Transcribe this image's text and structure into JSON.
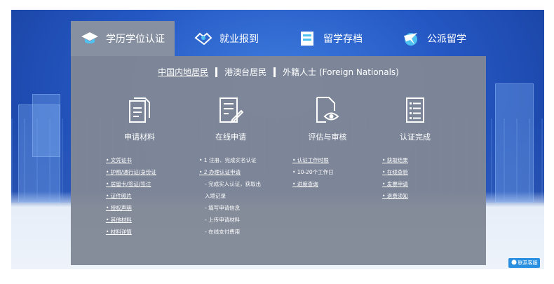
{
  "tabs": [
    {
      "label": "学历学位认证",
      "icon": "graduation-cap-icon",
      "active": true
    },
    {
      "label": "就业报到",
      "icon": "handshake-icon",
      "active": false
    },
    {
      "label": "留学存档",
      "icon": "file-cabinet-icon",
      "active": false
    },
    {
      "label": "公派留学",
      "icon": "airplane-globe-icon",
      "active": false
    }
  ],
  "subnav": {
    "mainland": "中国内地居民",
    "hkmt": "港澳台居民",
    "foreign": "外籍人士 (Foreign Nationals)"
  },
  "steps": [
    {
      "label": "申请材料",
      "icon": "documents-icon"
    },
    {
      "label": "在线申请",
      "icon": "form-edit-icon"
    },
    {
      "label": "评估与审核",
      "icon": "document-eye-icon"
    },
    {
      "label": "认证完成",
      "icon": "checklist-icon"
    }
  ],
  "materials": [
    "• 文凭证书",
    "• 护照/通行证/身份证",
    "• 居留卡/签证/签注",
    "• 证件照片",
    "• 授权声明",
    "• 其他材料",
    "• 材料详情"
  ],
  "apply": [
    "• 1 注册、完成实名认证",
    "• 2 办理认证申请",
    "  - 完成实人认证，获取出",
    "  入境记录",
    "  - 填写申请信息",
    "  - 上传申请材料",
    "  - 在线支付费用"
  ],
  "review": [
    "• 认证工作时限",
    "• 10-20个工作日",
    "• 进度查询"
  ],
  "complete": [
    "• 获取结果",
    "• 在线查验",
    "• 发票申请",
    "• 退费须知"
  ],
  "badge": {
    "label": "联系客服"
  },
  "colors": {
    "panel": "#8790a0",
    "banner": "#2558c4",
    "badge": "#2a8fe0"
  }
}
